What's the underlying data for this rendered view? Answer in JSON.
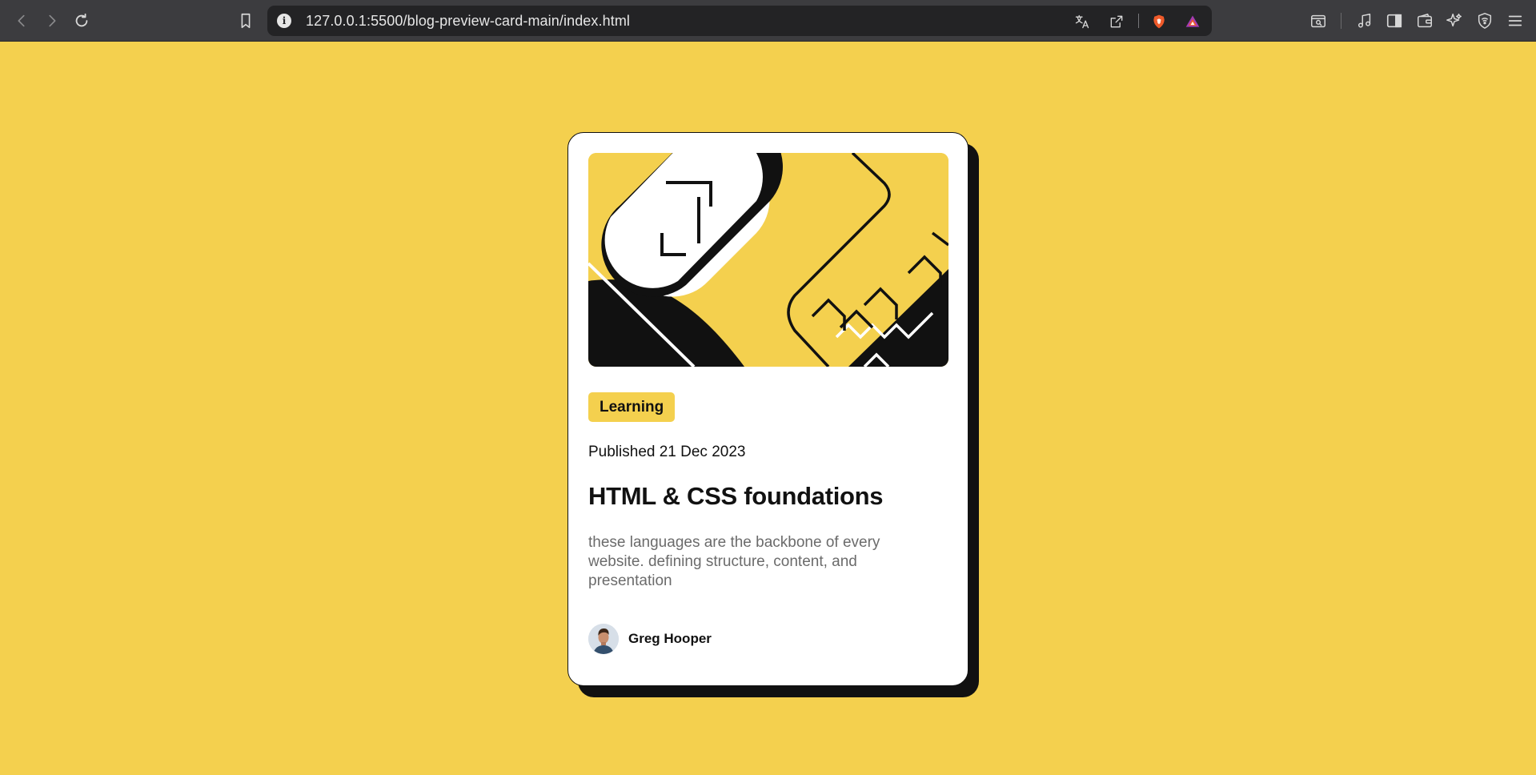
{
  "browser": {
    "url": "127.0.0.1:5500/blog-preview-card-main/index.html",
    "info_icon_glyph": "i",
    "icons": [
      "back-icon",
      "forward-icon",
      "reload-icon",
      "bookmark-icon",
      "info-icon",
      "translate-icon",
      "share-icon",
      "brave-shields-icon",
      "brave-rewards-icon",
      "search-tabs-icon",
      "media-icon",
      "sidebar-icon",
      "wallet-icon",
      "leo-ai-icon",
      "vpn-icon",
      "menu-icon"
    ]
  },
  "card": {
    "tag": "Learning",
    "published": "Published 21 Dec 2023",
    "title": "HTML & CSS foundations",
    "description": "these languages are the backbone of every website. defining structure, content, and presentation",
    "author": "Greg Hooper"
  },
  "colors": {
    "page_background": "#f4d04e",
    "card_background": "#ffffff",
    "ink": "#111111",
    "muted_text": "#6b6b6b",
    "toolbar": "#3c3c3f"
  }
}
